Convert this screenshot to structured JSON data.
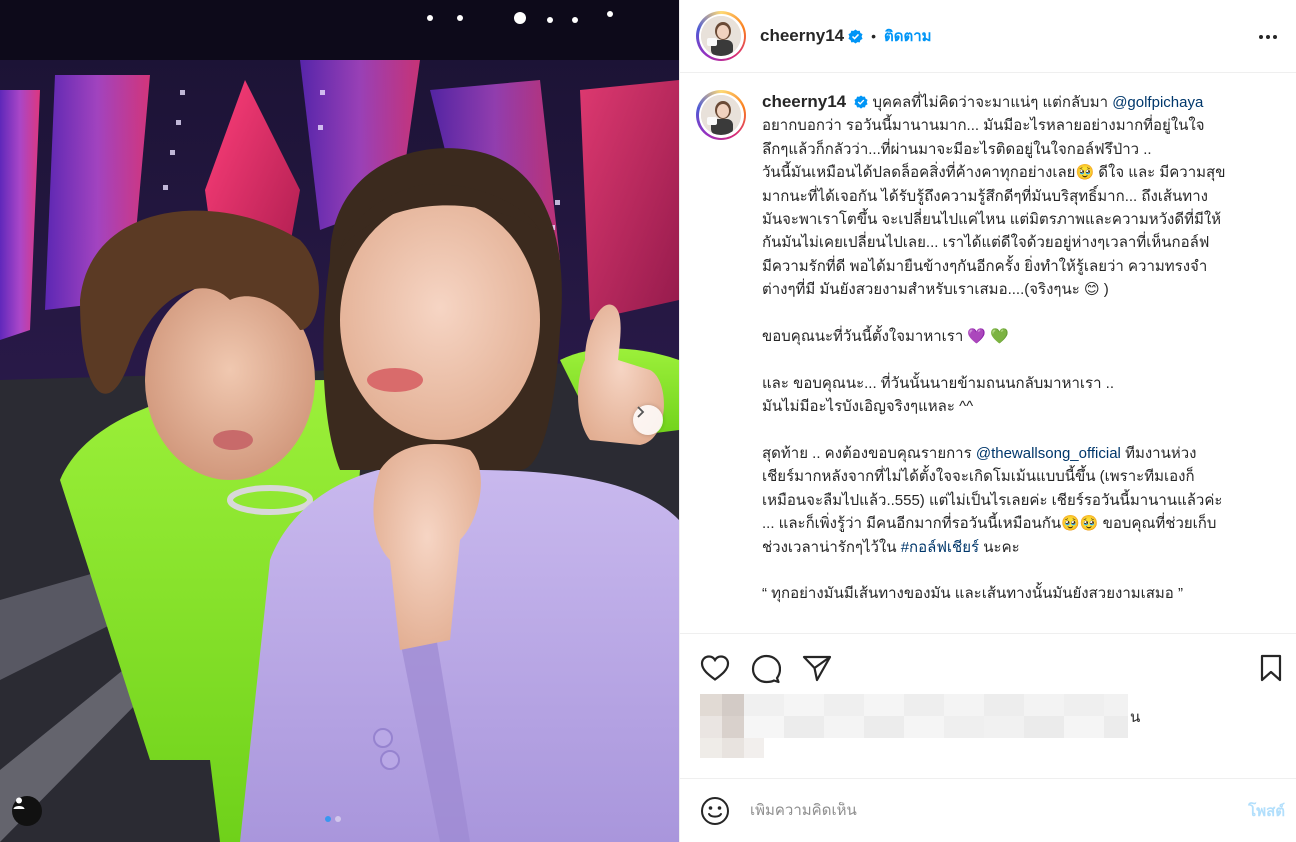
{
  "post": {
    "username": "cheerny14",
    "separator": "•",
    "follow_label": "ติดตาม",
    "verified": true,
    "icons": {
      "verified": "verified-badge-icon",
      "more": "more-options-icon",
      "like": "heart-icon",
      "comment": "comment-bubble-icon",
      "share": "paper-plane-icon",
      "save": "bookmark-icon",
      "emoji": "smiley-icon",
      "carousel_next": "chevron-right-icon",
      "tag_user": "user-tag-icon"
    },
    "colors": {
      "accent": "#0095f6",
      "mention": "#00376b",
      "post_disabled": "#b2dffc"
    }
  },
  "caption": {
    "l1_text": "บุคคลที่ไม่คิดว่าจะมาแน่ๆ แต่กลับมา",
    "l1_mention": "@golfpichaya",
    "l2": "อยากบอกว่า รอวันนี้มานานมาก... มันมีอะไรหลายอย่างมากที่อยู่ในใจ",
    "l3": "ลึกๆแล้วก็กลัวว่า...ที่ผ่านมาจะมีอะไรติดอยู่ในใจกอล์ฟรึป่าว ..",
    "l4": "วันนี้มันเหมือนได้ปลดล็อคสิ่งที่ค้างคาทุกอย่างเลย🥹 ดีใจ และ มีความสุข",
    "l5": "มากนะที่ได้เจอกัน ได้รับรู้ถึงความรู้สึกดีๆที่มันบริสุทธิ์มาก... ถึงเส้นทาง",
    "l6": "มันจะพาเราโตขึ้น จะเปลี่ยนไปแค่ไหน แต่มิตรภาพและความหวังดีที่มีให้",
    "l7": "กันมันไม่เคยเปลี่ยนไปเลย... เราได้แต่ดีใจด้วยอยู่ห่างๆเวลาที่เห็นกอล์ฟ",
    "l8": "มีความรักที่ดี พอได้มายืนข้างๆกันอีกครั้ง ยิ่งทำให้รู้เลยว่า ความทรงจำ",
    "l9": "ต่างๆที่มี มันยังสวยงามสำหรับเราเสมอ....(จริงๆนะ 😊 )",
    "l10": "ขอบคุณนะที่วันนี้ตั้งใจมาหาเรา 💜 💚",
    "l11": "และ ขอบคุณนะ... ที่วันนั้นนายข้ามถนนกลับมาหาเรา ..",
    "l12": "มันไม่มีอะไรบังเอิญจริงๆแหละ ^^",
    "l13_pre": "สุดท้าย .. คงต้องขอบคุณรายการ",
    "l13_mention": "@thewallsong_official",
    "l13_post": "ทีมงานห่วง",
    "l14": "เชียร์มากหลังจากที่ไม่ได้ตั้งใจจะเกิดโมเม้นแบบนี้ขึ้น (เพราะทีมเองก็",
    "l15": "เหมือนจะลืมไปแล้ว..555) แต่ไม่เป็นไรเลยค่ะ เชียร์รอวันนี้มานานแล้วค่ะ",
    "l16": "... และก็เพิ่งรู้ว่า มีคนอีกมากที่รอวันนี้เหมือนกัน🥹🥹 ขอบคุณที่ช่วยเก็บ",
    "l17_pre": "ช่วงเวลาน่ารักๆไว้ใน",
    "l17_hashtag": "#กอล์ฟเชียร์",
    "l17_post": "นะคะ",
    "l18": "“ ทุกอย่างมันมีเส้นทางของมัน และเส้นทางนั้นมันยังสวยงามเสมอ ”"
  },
  "likes": {
    "visible_suffix": "น"
  },
  "comment": {
    "placeholder": "เพิ่มความคิดเห็น",
    "post_label": "โพสต์"
  },
  "carousel": {
    "current": 1,
    "total": 2
  }
}
